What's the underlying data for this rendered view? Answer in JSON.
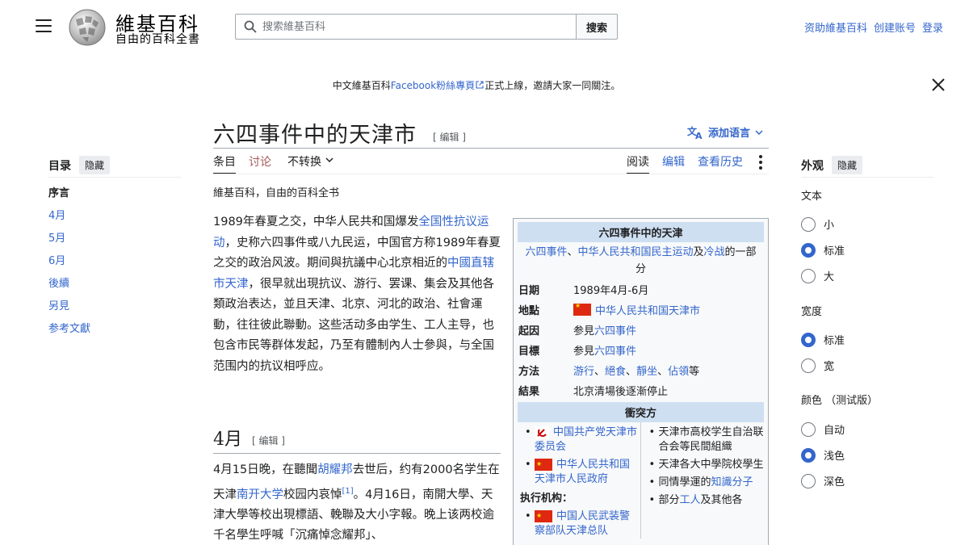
{
  "header": {
    "site_name": "維基百科",
    "tagline": "自由的百科全書",
    "search_placeholder": "搜索維基百科",
    "search_button": "搜索",
    "user_links": [
      "资助維基百科",
      "创建账号",
      "登录"
    ]
  },
  "notice": {
    "prefix": "中文維基百科",
    "link": "Facebook粉絲專頁",
    "suffix": "正式上線，邀請大家一同關注。"
  },
  "toc": {
    "title": "目录",
    "hide": "隐藏",
    "items": [
      "序言",
      "4月",
      "5月",
      "6月",
      "後續",
      "另見",
      "参考文獻"
    ]
  },
  "page": {
    "title": "六四事件中的天津市",
    "edit": "[ 编辑 ]",
    "add_languages": "添加语言",
    "tabs_left": [
      "条目",
      "讨论",
      "不转换"
    ],
    "tabs_right": [
      "阅读",
      "编辑",
      "查看历史"
    ],
    "from": "維基百科，自由的百科全书",
    "para1": {
      "t1": "1989年春夏之交，中华人民共和国爆发",
      "l1": "全国性抗议运动",
      "t2": "，史称六四事件或八九民运，中国官方称1989年春夏之交的政治风波。期间與抗議中心北京相近的",
      "l2": "中國直辖市天津",
      "t3": "，很早就出現抗议、游行、罢课、集会及其他各類政治表达，並且天津、北京、河北的政治、社會運動，往往彼此聯動。这些活动多由学生、工人主导，也包含市民等群体发起，乃至有體制內人士參與，与全国范围内的抗议相呼应。"
    },
    "section_april": "4月",
    "para2": {
      "t1": "4月15日晚，在聽聞",
      "l1": "胡耀邦",
      "t2": "去世后，约有2000名学生在天津",
      "l2": "南开大学",
      "t3": "校园内哀悼",
      "ref": "[1]",
      "t4": "。4月16日，南開大學、天津大學等校出現標語、輓聯及大小字報。晚上该两校逾千名學生呼喊「沉痛悼念耀邦」、"
    }
  },
  "infobox": {
    "title": "六四事件中的天津",
    "part_of": {
      "l1": "六四事件",
      "sep1": "、",
      "l2": "中华人民共和国民主运动",
      "sep2": "及",
      "l3": "冷战",
      "suffix": "的一部分"
    },
    "rows": [
      {
        "key": "日期",
        "value": "1989年4月-6月"
      },
      {
        "key": "地點",
        "link": "中华人民共和国天津市"
      },
      {
        "key": "起因",
        "pre": "参見",
        "link": "六四事件"
      },
      {
        "key": "目標",
        "pre": "参見",
        "link": "六四事件"
      },
      {
        "key": "方法",
        "links": [
          "游行",
          "絕食",
          "靜坐",
          "佔領"
        ],
        "suffix": "等"
      },
      {
        "key": "結果",
        "value": "北京清場後逐漸停止"
      }
    ],
    "parties_title": "衝突方",
    "left_party_1": "中国共产党天津市委员会",
    "left_party_2": "中华人民共和国天津市人民政府",
    "executors_title": "执行机构：",
    "left_party_3": "中国人民武装警察部队天津总队",
    "right_1": "天津市高校学生自治联合会等民間組織",
    "right_2": "天津各大中學院校學生",
    "right_3_pre": "同情學運的",
    "right_3_link": "知識分子",
    "right_4_pre": "部分",
    "right_4_link": "工人",
    "right_4_suffix": "及其他各"
  },
  "appearance": {
    "title": "外观",
    "hide": "隐藏",
    "text_label": "文本",
    "text_options": [
      "小",
      "标准",
      "大"
    ],
    "text_selected": 1,
    "width_label": "宽度",
    "width_options": [
      "标准",
      "宽"
    ],
    "width_selected": 0,
    "color_label": "颜色 （测试版）",
    "color_options": [
      "自动",
      "浅色",
      "深色"
    ],
    "color_selected": 1
  },
  "colors": {
    "link": "#3366cc",
    "infobox_header": "#cedff2",
    "talk_tab": "#a55858"
  }
}
